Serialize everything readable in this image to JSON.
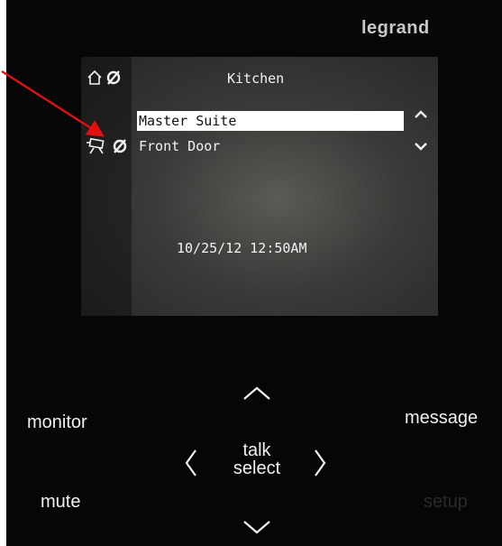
{
  "brand": "legrand",
  "screen": {
    "title": "Kitchen",
    "items": [
      {
        "label": "Master Suite",
        "selected": true
      },
      {
        "label": "Front Door",
        "selected": false
      }
    ],
    "datetime": "10/25/12 12:50AM"
  },
  "buttons": {
    "monitor": "monitor",
    "message": "message",
    "mute": "mute",
    "setup": "setup",
    "talk": "talk",
    "select": "select"
  },
  "colors": {
    "panel": "#060606",
    "annotation_arrow": "#e01010"
  },
  "icons": [
    "home-icon",
    "mute-icon",
    "camera-icon",
    "chevron-up-icon",
    "chevron-down-icon",
    "chevron-left-icon",
    "chevron-right-icon"
  ]
}
